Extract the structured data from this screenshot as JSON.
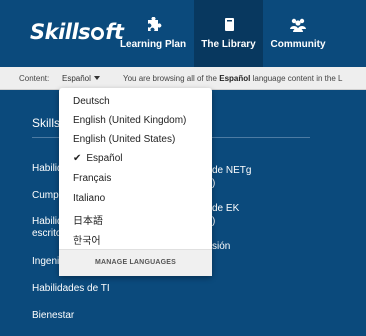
{
  "header": {
    "logo_text_a": "Skills",
    "logo_text_b": "ft",
    "nav": [
      {
        "label": "Learning Plan",
        "icon": "puzzle-icon"
      },
      {
        "label": "The Library",
        "icon": "book-icon"
      },
      {
        "label": "Community",
        "icon": "people-icon"
      }
    ]
  },
  "content_bar": {
    "label": "Content:",
    "selected": "Español",
    "info_prefix": "You are browsing all of the",
    "info_lang": "Español",
    "info_suffix": "language content in the L"
  },
  "library": {
    "section_title": "Skills",
    "left_links": [
      "Habilid",
      "Cump",
      "Habilid",
      "escrito",
      "Ingeni",
      "Habilidades de TI",
      "Bienestar"
    ],
    "right_fragments": [
      "de NETg",
      ")",
      "de EK",
      ")",
      "sión"
    ]
  },
  "language_menu": {
    "items": [
      "Deutsch",
      "English (United Kingdom)",
      "English (United States)",
      "Español",
      "Français",
      "Italiano",
      "日本語",
      "한국어"
    ],
    "selected_index": 3,
    "manage_label": "MANAGE LANGUAGES"
  },
  "colors": {
    "header_bg": "#0b4a7c",
    "active_tab_bg": "#08385f",
    "page_bg": "#0b4a7c"
  }
}
